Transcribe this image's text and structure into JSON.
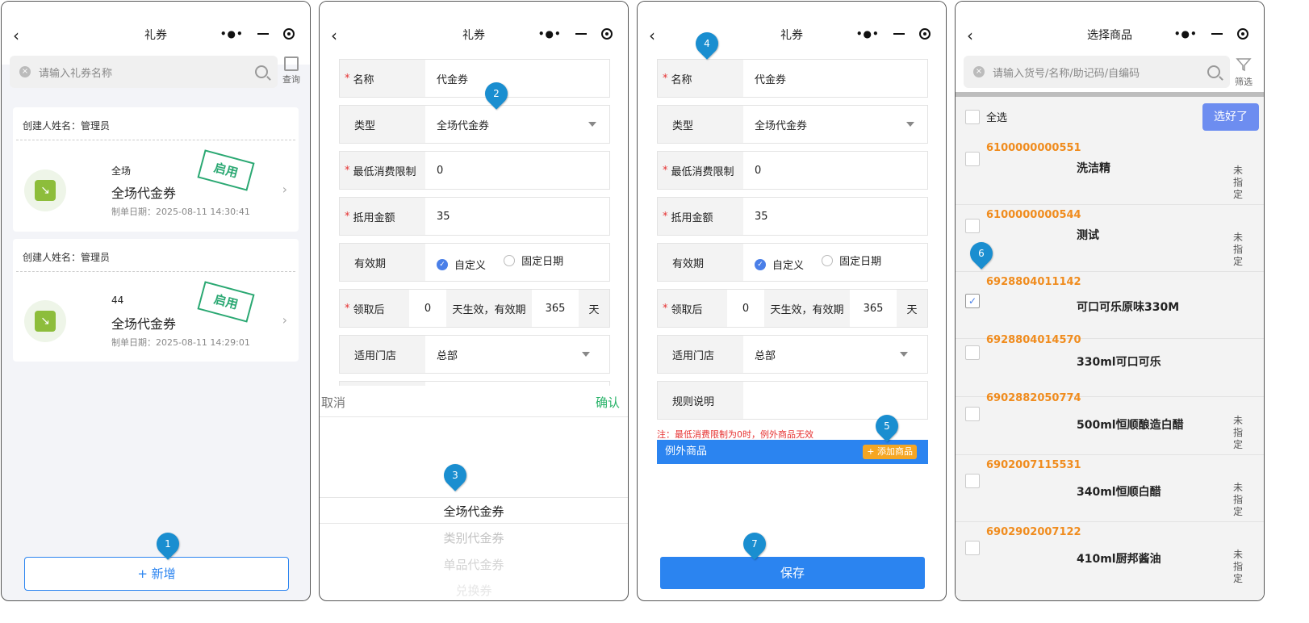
{
  "screen1": {
    "title": "礼券",
    "search_placeholder": "请输入礼券名称",
    "query_label": "查询",
    "cards": [
      {
        "creator": "创建人姓名：管理员",
        "scope": "全场",
        "name": "全场代金券",
        "date": "制单日期：2025-08-11 14:30:41",
        "status": "启用"
      },
      {
        "creator": "创建人姓名：管理员",
        "scope": "44",
        "name": "全场代金券",
        "date": "制单日期：2025-08-11 14:29:01",
        "status": "启用"
      }
    ],
    "add_button": "新增",
    "add_icon": "+"
  },
  "screen2": {
    "title": "礼券",
    "fields": {
      "name_label": "名称",
      "name_value": "代金券",
      "type_label": "类型",
      "type_value": "全场代金券",
      "min_label": "最低消费限制",
      "min_value": "0",
      "amount_label": "抵用金额",
      "amount_value": "35",
      "validity_label": "有效期",
      "opt_custom": "自定义",
      "opt_fixed": "固定日期",
      "after_label": "领取后",
      "after_days": "0",
      "effective_text": "天生效，有效期",
      "valid_days": "365",
      "day_unit": "天",
      "store_label": "适用门店",
      "store_value": "总部"
    },
    "picker": {
      "cancel": "取消",
      "confirm": "确认",
      "options": [
        "全场代金券",
        "类别代金券",
        "单品代金券",
        "兑换券"
      ]
    }
  },
  "screen3": {
    "title": "礼券",
    "fields": {
      "name_label": "名称",
      "name_value": "代金券",
      "type_label": "类型",
      "type_value": "全场代金券",
      "min_label": "最低消费限制",
      "min_value": "0",
      "amount_label": "抵用金额",
      "amount_value": "35",
      "validity_label": "有效期",
      "opt_custom": "自定义",
      "opt_fixed": "固定日期",
      "after_label": "领取后",
      "after_days": "0",
      "effective_text": "天生效，有效期",
      "valid_days": "365",
      "day_unit": "天",
      "store_label": "适用门店",
      "store_value": "总部",
      "rule_label": "规则说明"
    },
    "note": "注：最低消费限制为0时，例外商品无效",
    "except_label": "例外商品",
    "add_goods": "+ 添加商品",
    "save": "保存"
  },
  "screen4": {
    "title": "选择商品",
    "search_placeholder": "请输入货号/名称/助记码/自编码",
    "filter_label": "筛选",
    "select_all": "全选",
    "done_button": "选好了",
    "items": [
      {
        "code": "6100000000551",
        "name": "洗洁精",
        "status": "未指定",
        "checked": false
      },
      {
        "code": "6100000000544",
        "name": "测试",
        "status": "未指定",
        "checked": false
      },
      {
        "code": "6928804011142",
        "name": "可口可乐原味330M",
        "status": "",
        "checked": true
      },
      {
        "code": "6928804014570",
        "name": "330ml可口可乐",
        "status": "",
        "checked": false
      },
      {
        "code": "6902882050774",
        "name": "500ml恒顺酿造白醋",
        "status": "未指定",
        "checked": false
      },
      {
        "code": "6902007115531",
        "name": "340ml恒顺白醋",
        "status": "未指定",
        "checked": false
      },
      {
        "code": "6902902007122",
        "name": "410ml厨邦酱油",
        "status": "未指定",
        "checked": false
      }
    ]
  },
  "markers": [
    "1",
    "2",
    "3",
    "4",
    "5",
    "6",
    "7"
  ],
  "icons": {
    "back": "‹",
    "clear": "×",
    "check": "✓",
    "arrow": "›",
    "cal": "↘"
  },
  "colors": {
    "accent": "#2b84f0",
    "marker": "#1a8ed0",
    "stamp": "#2aa872",
    "code": "#f08c1e",
    "required": "#e63232"
  }
}
